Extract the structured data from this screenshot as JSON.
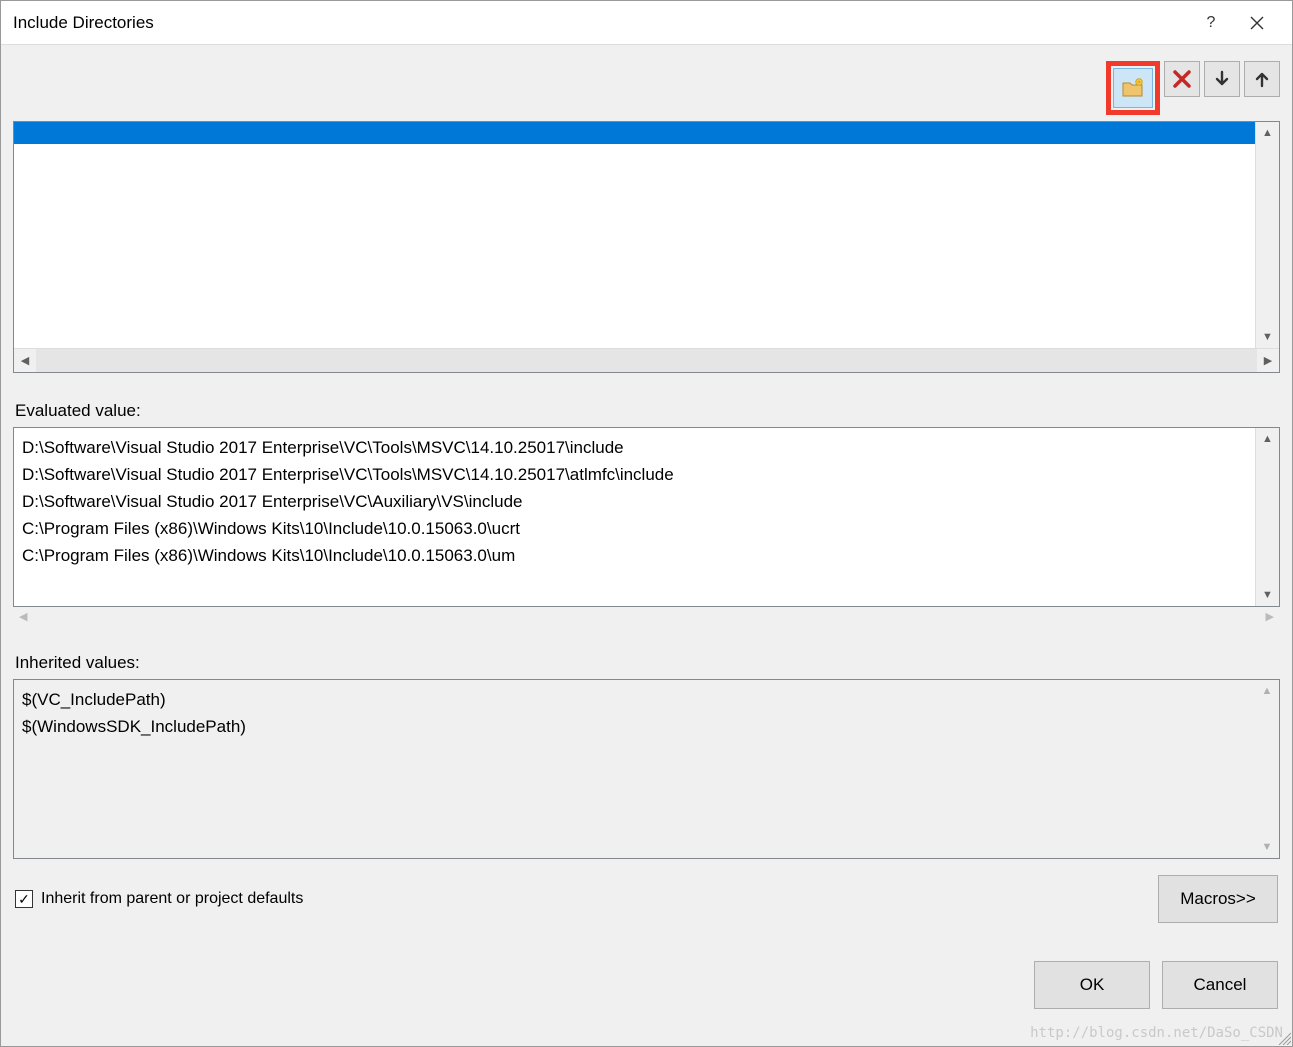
{
  "window": {
    "title": "Include Directories",
    "help": "?",
    "close": "✕"
  },
  "toolbar": {
    "new_folder": "new-folder",
    "delete": "delete",
    "move_down": "move-down",
    "move_up": "move-up"
  },
  "evaluated": {
    "label": "Evaluated value:",
    "lines": [
      "D:\\Software\\Visual Studio 2017 Enterprise\\VC\\Tools\\MSVC\\14.10.25017\\include",
      "D:\\Software\\Visual Studio 2017 Enterprise\\VC\\Tools\\MSVC\\14.10.25017\\atlmfc\\include",
      "D:\\Software\\Visual Studio 2017 Enterprise\\VC\\Auxiliary\\VS\\include",
      "C:\\Program Files (x86)\\Windows Kits\\10\\Include\\10.0.15063.0\\ucrt",
      "C:\\Program Files (x86)\\Windows Kits\\10\\Include\\10.0.15063.0\\um"
    ]
  },
  "inherited": {
    "label": "Inherited values:",
    "lines": [
      "$(VC_IncludePath)",
      "$(WindowsSDK_IncludePath)"
    ]
  },
  "inherit_checkbox": {
    "checked": true,
    "label": "Inherit from parent or project defaults"
  },
  "buttons": {
    "macros": "Macros>>",
    "ok": "OK",
    "cancel": "Cancel"
  },
  "watermark": "http://blog.csdn.net/DaSo_CSDN"
}
